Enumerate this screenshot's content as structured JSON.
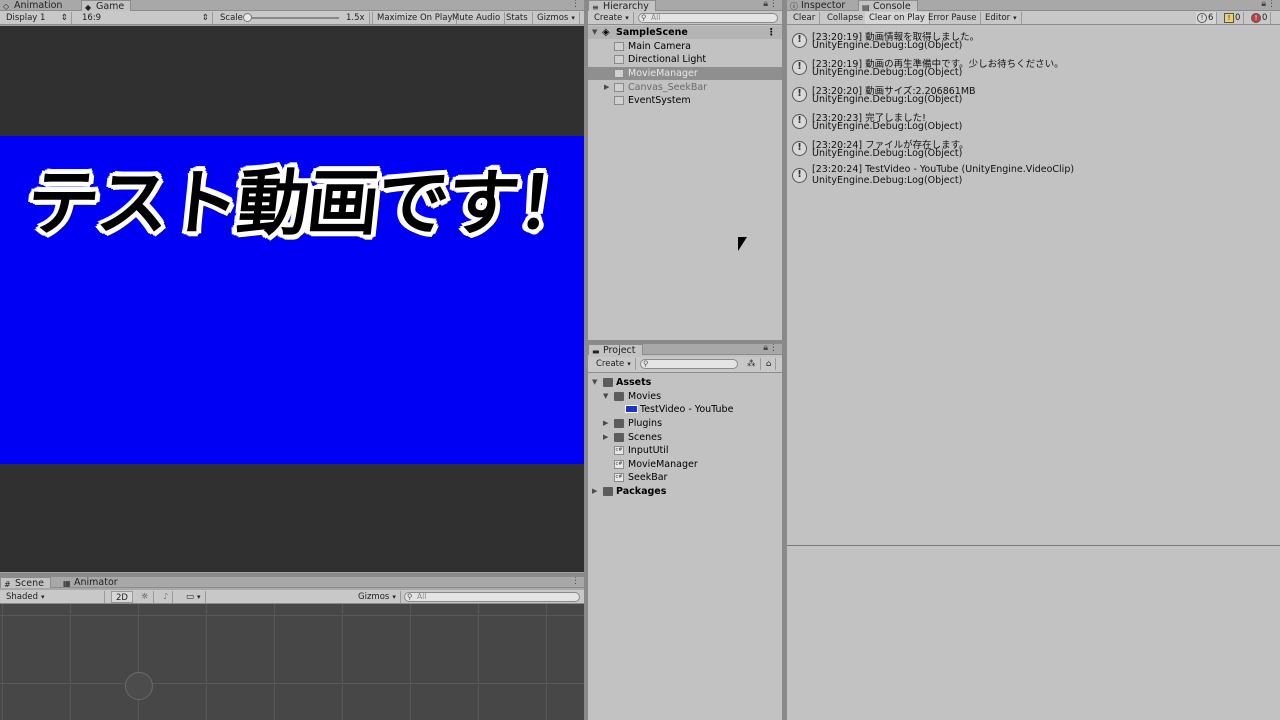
{
  "game_panel": {
    "tabs": [
      {
        "label": "Animation",
        "icon": "animation-icon"
      },
      {
        "label": "Game",
        "icon": "game-icon"
      }
    ],
    "toolbar": {
      "display": "Display 1",
      "aspect": "16:9",
      "scale_label": "Scale",
      "scale_value": "1.5x",
      "maximize_on_play": "Maximize On Play",
      "mute_audio": "Mute Audio",
      "stats": "Stats",
      "gizmos": "Gizmos"
    },
    "video_title": "テスト動画です！",
    "video_bg_color": "#0000f5"
  },
  "scene_panel": {
    "tabs": [
      {
        "label": "Scene",
        "icon": "grid-icon"
      },
      {
        "label": "Animator",
        "icon": "animator-icon"
      }
    ],
    "toolbar": {
      "shading": "Shaded",
      "mode_2d": "2D",
      "gizmos": "Gizmos",
      "search_placeholder": "All"
    }
  },
  "hierarchy": {
    "tab_label": "Hierarchy",
    "create_label": "Create",
    "search_placeholder": "All",
    "scene_name": "SampleScene",
    "items": [
      {
        "label": "Main Camera"
      },
      {
        "label": "Directional Light"
      },
      {
        "label": "MovieManager"
      },
      {
        "label": "Canvas_SeekBar"
      },
      {
        "label": "EventSystem"
      }
    ]
  },
  "project": {
    "tab_label": "Project",
    "create_label": "Create",
    "items": [
      {
        "label": "Assets",
        "icon": "folder-icon"
      },
      {
        "label": "Movies",
        "icon": "folder-icon"
      },
      {
        "label": "TestVideo - YouTube",
        "icon": "video-clip-icon"
      },
      {
        "label": "Plugins",
        "icon": "folder-icon"
      },
      {
        "label": "Scenes",
        "icon": "folder-icon"
      },
      {
        "label": "InputUtil",
        "icon": "script-icon"
      },
      {
        "label": "MovieManager",
        "icon": "script-icon"
      },
      {
        "label": "SeekBar",
        "icon": "script-icon"
      },
      {
        "label": "Packages",
        "icon": "folder-icon"
      }
    ]
  },
  "console": {
    "tabs": [
      {
        "label": "Inspector",
        "icon": "info-icon"
      },
      {
        "label": "Console",
        "icon": "console-icon"
      }
    ],
    "toolbar": {
      "clear": "Clear",
      "collapse": "Collapse",
      "clear_on_play": "Clear on Play",
      "error_pause": "Error Pause",
      "editor": "Editor",
      "log_count": "6",
      "warning_count": "0",
      "error_count": "0"
    },
    "logs": [
      {
        "line1": "[23:20:19] 動画情報を取得しました。",
        "line2": "UnityEngine.Debug:Log(Object)"
      },
      {
        "line1": "[23:20:19] 動画の再生準備中です。少しお待ちください。",
        "line2": "UnityEngine.Debug:Log(Object)"
      },
      {
        "line1": "[23:20:20] 動画サイズ:2.206861MB",
        "line2": "UnityEngine.Debug:Log(Object)"
      },
      {
        "line1": "[23:20:23] 完了しました!",
        "line2": "UnityEngine.Debug:Log(Object)"
      },
      {
        "line1": "[23:20:24] ファイルが存在します。",
        "line2": "UnityEngine.Debug:Log(Object)"
      },
      {
        "line1": "[23:20:24] TestVideo - YouTube (UnityEngine.VideoClip)",
        "line2": "UnityEngine.Debug:Log(Object)"
      }
    ]
  }
}
